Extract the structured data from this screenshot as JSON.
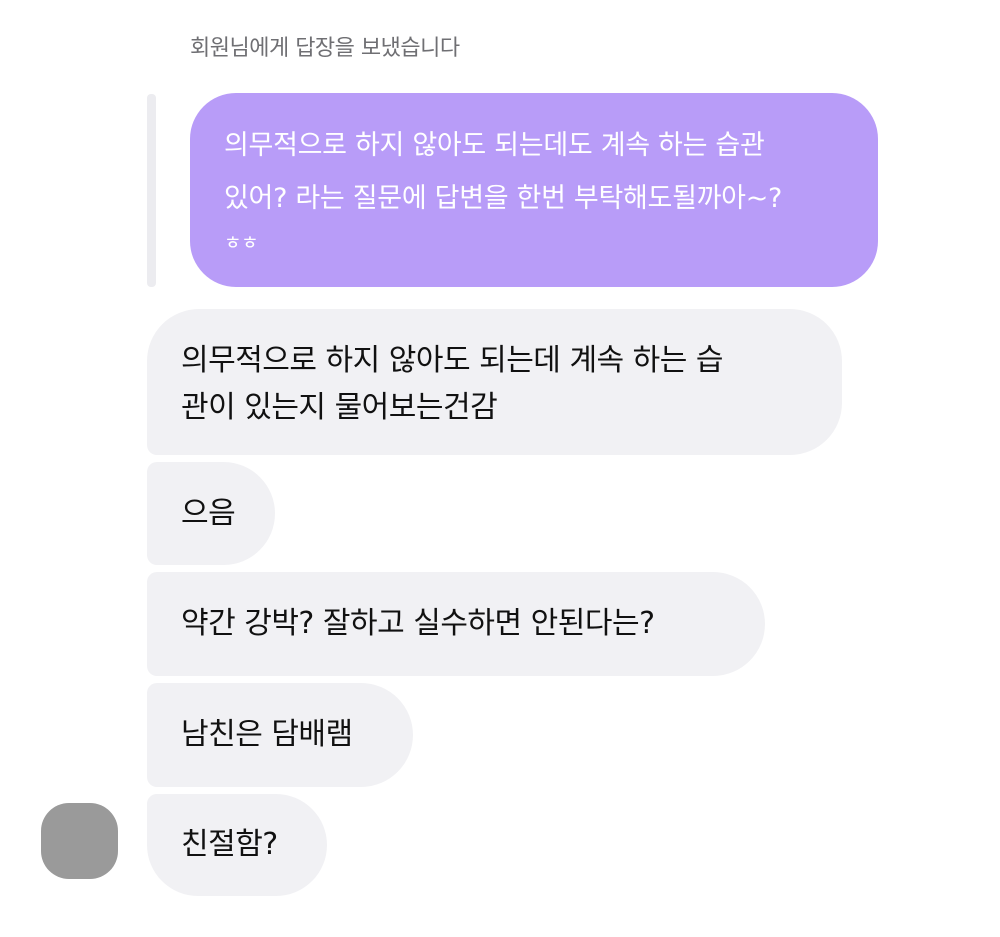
{
  "reply_header": "회원님에게 답장을 보냈습니다",
  "quoted_message": {
    "lines": [
      "의무적으로 하지 않아도 되는데도 계속 하는 습관",
      "있어? 라는 질문에 답변을 한번 부탁해도될까아~?",
      "ㅎㅎ"
    ]
  },
  "messages": [
    {
      "lines": [
        "의무적으로 하지 않아도 되는데 계속 하는 습",
        "관이 있는지 물어보는건감"
      ]
    },
    {
      "lines": [
        "으음"
      ]
    },
    {
      "lines": [
        "약간 강박? 잘하고 실수하면 안된다는?"
      ]
    },
    {
      "lines": [
        "남친은 담배램"
      ]
    },
    {
      "lines": [
        "친절함?"
      ]
    }
  ],
  "colors": {
    "quoted_bubble": "#b89cf8",
    "received_bubble": "#f1f1f4",
    "avatar_placeholder": "#9a9a9a"
  }
}
